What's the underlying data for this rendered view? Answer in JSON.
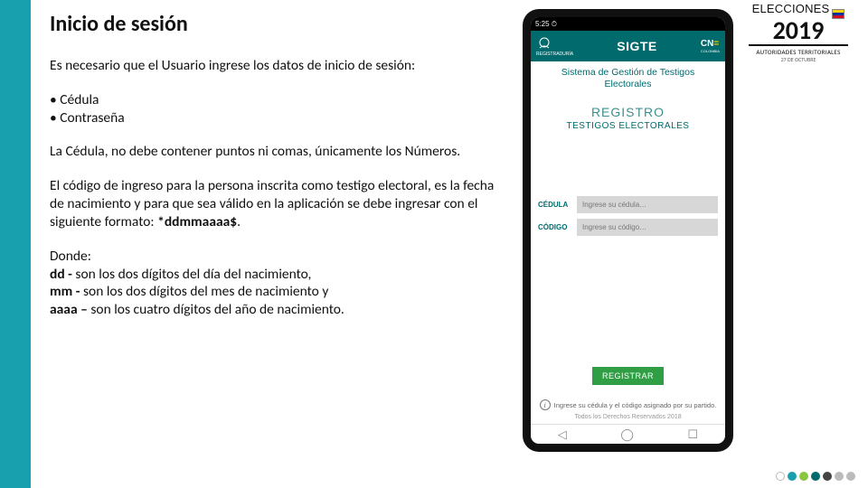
{
  "title": "Inicio de sesión",
  "intro": "Es necesario que el Usuario ingrese los datos de inicio de sesión:",
  "bullet1": "• Cédula",
  "bullet2": "• Contraseña",
  "p_cedula": "La Cédula, no debe contener puntos ni comas, únicamente los Números.",
  "p_codigo_a": "El código de ingreso para la persona inscrita como testigo electoral, es la fecha de nacimiento y para que sea válido en la aplicación se debe ingresar con el siguiente formato: ",
  "p_codigo_b": "*ddmmaaaa$",
  "p_codigo_c": ".",
  "donde_label": "Donde:",
  "dd_b": "dd -",
  "dd_t": " son los dos dígitos del día del nacimiento,",
  "mm_b": "mm -",
  "mm_t": " son los dos dígitos del mes de nacimiento y",
  "aa_b": "aaaa –",
  "aa_t": " son los cuatro dígitos del año de nacimiento.",
  "phone": {
    "status_time": "5:25 ⏱",
    "app_name": "SIGTE",
    "reg_tiny": "REGISTRADURÍA",
    "cne": "CNE",
    "subtitle1": "Sistema de Gestión de Testigos",
    "subtitle2": "Electorales",
    "registro": "REGISTRO",
    "testigos": "TESTIGOS ELECTORALES",
    "cedula_label": "CÉDULA",
    "cedula_ph": "Ingrese su cédula…",
    "codigo_label": "CÓDIGO",
    "codigo_ph": "Ingrese su código…",
    "registrar": "REGISTRAR",
    "hint": "Ingrese su cédula y el código asignado por su partido.",
    "footer": "Todos los Derechos Reservados 2018"
  },
  "logo": {
    "elecciones": "ELECCIONES",
    "year": "2019",
    "line2": "AUTORIDADES TERRITORIALES",
    "line3": "27 DE OCTUBRE"
  }
}
